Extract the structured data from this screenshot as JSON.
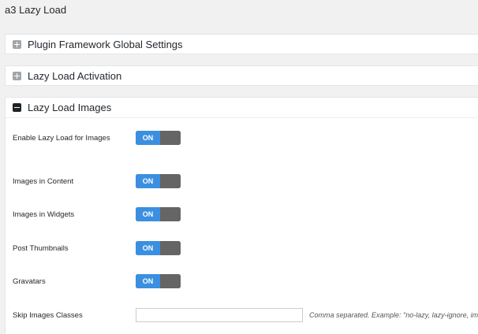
{
  "page": {
    "title": "a3 Lazy Load"
  },
  "sections": [
    {
      "title": "Plugin Framework Global Settings",
      "expanded": false,
      "icon": "plus-square-icon"
    },
    {
      "title": "Lazy Load Activation",
      "expanded": false,
      "icon": "plus-square-icon"
    },
    {
      "title": "Lazy Load Images",
      "expanded": true,
      "icon": "minus-square-icon"
    }
  ],
  "images_settings": {
    "enable": {
      "label": "Enable Lazy Load for Images",
      "toggle": "ON"
    },
    "content": {
      "label": "Images in Content",
      "toggle": "ON"
    },
    "widgets": {
      "label": "Images in Widgets",
      "toggle": "ON"
    },
    "thumbnails": {
      "label": "Post Thumbnails",
      "toggle": "ON"
    },
    "gravatars": {
      "label": "Gravatars",
      "toggle": "ON"
    },
    "skip_classes": {
      "label": "Skip Images Classes",
      "value": "",
      "hint": "Comma separated. Example: \"no-lazy, lazy-ignore, im"
    }
  },
  "colors": {
    "toggle_on": "#3b8fe0",
    "toggle_off": "#656565",
    "background": "#f1f1f1"
  }
}
